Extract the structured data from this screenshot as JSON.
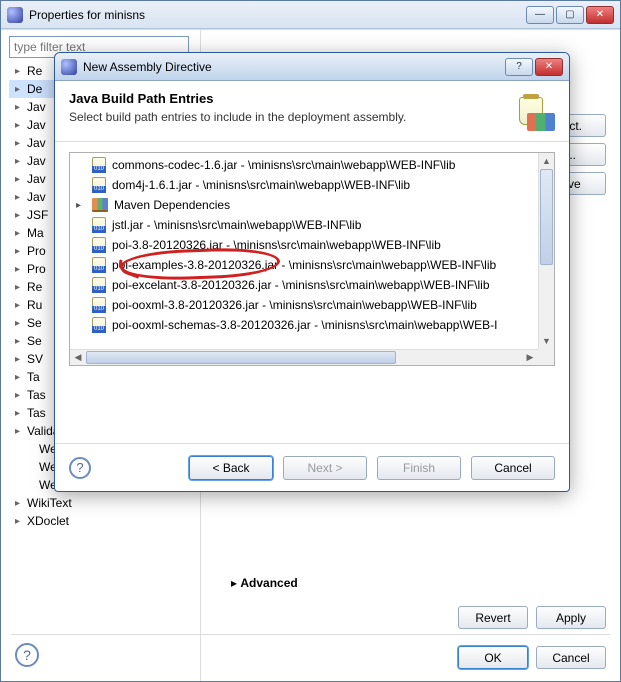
{
  "parent": {
    "title": "Properties for minisns",
    "filter_placeholder": "type filter text",
    "tree": [
      {
        "label": "Re",
        "expandable": true
      },
      {
        "label": "De",
        "expandable": true,
        "selected": true
      },
      {
        "label": "Jav",
        "expandable": true
      },
      {
        "label": "Jav",
        "expandable": true
      },
      {
        "label": "Jav",
        "expandable": true
      },
      {
        "label": "Jav",
        "expandable": true
      },
      {
        "label": "Jav",
        "expandable": true
      },
      {
        "label": "Jav",
        "expandable": true
      },
      {
        "label": "JSF",
        "expandable": true
      },
      {
        "label": "Ma",
        "expandable": true
      },
      {
        "label": "Pro",
        "expandable": true
      },
      {
        "label": "Pro",
        "expandable": true
      },
      {
        "label": "Re",
        "expandable": true
      },
      {
        "label": "Ru",
        "expandable": true
      },
      {
        "label": "Se",
        "expandable": true
      },
      {
        "label": "Se",
        "expandable": true
      },
      {
        "label": "SV",
        "expandable": true
      },
      {
        "label": "Ta",
        "expandable": true
      },
      {
        "label": "Tas",
        "expandable": true
      },
      {
        "label": "Tas",
        "expandable": true
      },
      {
        "label": "Validation",
        "expandable": true
      },
      {
        "label": "Web Content Settings",
        "expandable": false,
        "indent": true
      },
      {
        "label": "Web Page Editor",
        "expandable": false,
        "indent": true
      },
      {
        "label": "Web Project Settings",
        "expandable": false,
        "indent": true
      },
      {
        "label": "WikiText",
        "expandable": true
      },
      {
        "label": "XDoclet",
        "expandable": true
      }
    ],
    "right": {
      "side_buttons": {
        "project": "ject.",
        "ellipsis": "...",
        "remove": "ove"
      },
      "advanced": "Advanced",
      "revert": "Revert",
      "apply": "Apply",
      "ok": "OK",
      "cancel": "Cancel"
    }
  },
  "dialog": {
    "title": "New Assembly Directive",
    "heading": "Java Build Path Entries",
    "subheading": "Select build path entries to include in the deployment assembly.",
    "items": [
      {
        "type": "jar",
        "label": "commons-codec-1.6.jar - \\minisns\\src\\main\\webapp\\WEB-INF\\lib"
      },
      {
        "type": "jar",
        "label": "dom4j-1.6.1.jar - \\minisns\\src\\main\\webapp\\WEB-INF\\lib"
      },
      {
        "type": "lib",
        "label": "Maven Dependencies",
        "expandable": true
      },
      {
        "type": "jar",
        "label": "jstl.jar - \\minisns\\src\\main\\webapp\\WEB-INF\\lib"
      },
      {
        "type": "jar",
        "label": "poi-3.8-20120326.jar - \\minisns\\src\\main\\webapp\\WEB-INF\\lib"
      },
      {
        "type": "jar",
        "label": "poi-examples-3.8-20120326.jar - \\minisns\\src\\main\\webapp\\WEB-INF\\lib"
      },
      {
        "type": "jar",
        "label": "poi-excelant-3.8-20120326.jar - \\minisns\\src\\main\\webapp\\WEB-INF\\lib"
      },
      {
        "type": "jar",
        "label": "poi-ooxml-3.8-20120326.jar - \\minisns\\src\\main\\webapp\\WEB-INF\\lib"
      },
      {
        "type": "jar",
        "label": "poi-ooxml-schemas-3.8-20120326.jar - \\minisns\\src\\main\\webapp\\WEB-I"
      }
    ],
    "buttons": {
      "back": "< Back",
      "next": "Next >",
      "finish": "Finish",
      "cancel": "Cancel"
    }
  }
}
